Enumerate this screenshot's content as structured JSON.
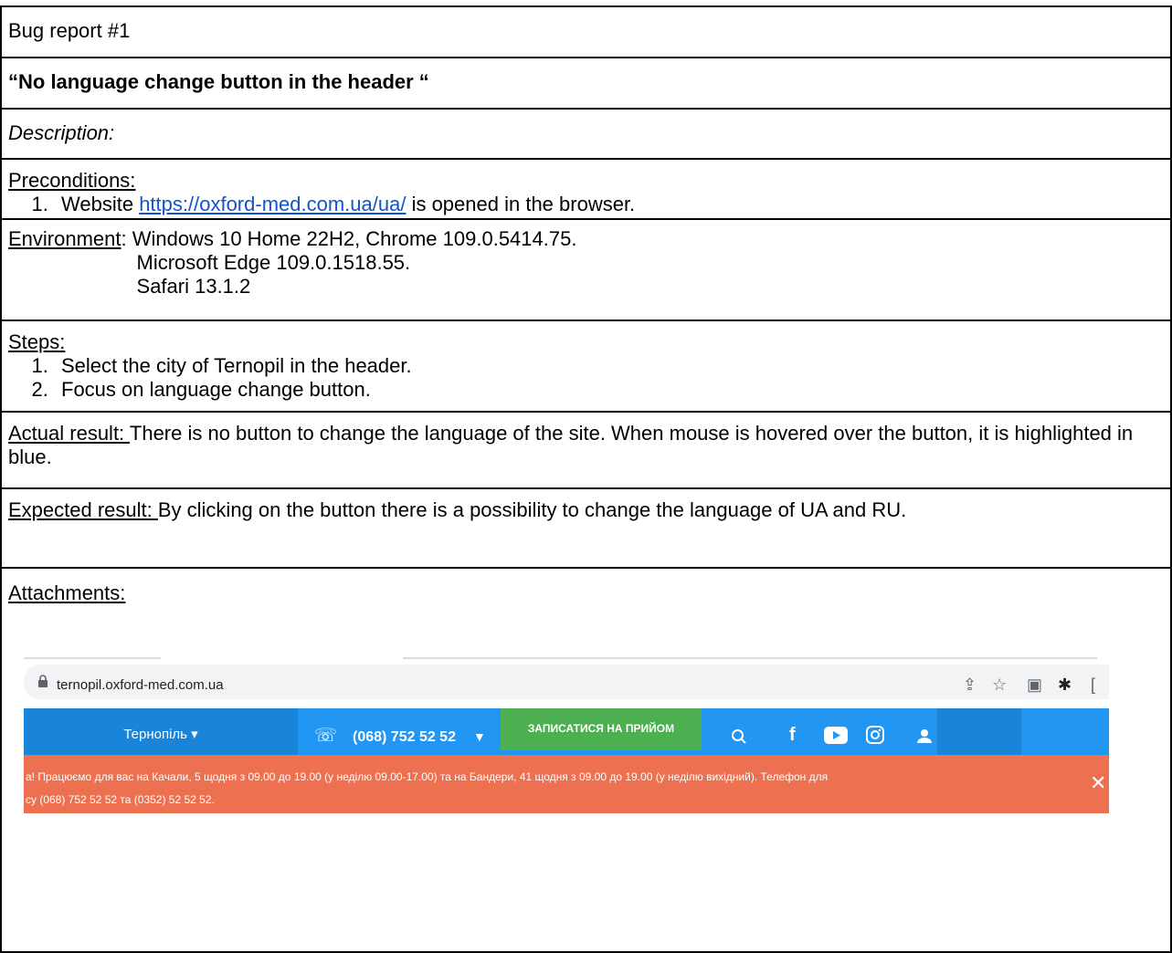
{
  "title": "Bug report #1",
  "heading": "“No language change button in the header “",
  "description_label": "Description:",
  "preconditions": {
    "label": "Preconditions:",
    "item_prefix": "Website ",
    "link": "https://oxford-med.com.ua/ua/",
    "item_suffix": " is opened in the browser."
  },
  "environment": {
    "label": "Environment",
    "line1": ": Windows 10 Home 22H2, Chrome 109.0.5414.75.",
    "line2": "Microsoft Edge 109.0.1518.55.",
    "line3": "Safari 13.1.2"
  },
  "steps": {
    "label": "Steps:",
    "items": [
      "Select the city of Ternopil in the header.",
      "Focus on language change button."
    ]
  },
  "actual": {
    "label": "Actual result: ",
    "text": "There is no button to change the language of the site. When mouse is hovered over the button, it is highlighted in blue."
  },
  "expected": {
    "label": "Expected result: ",
    "text": "By clicking on the button there is a possibility to change the language of UA and RU."
  },
  "attachments_label": "Attachments:",
  "screenshot": {
    "url": "ternopil.oxford-med.com.ua",
    "city": "Тернопіль",
    "phone": "(068) 752 52 52",
    "cta": "ЗАПИСАТИСЯ НА ПРИЙОМ",
    "notice_line1": "а! Працюємо для вас на Качали, 5 щодня з 09.00 до 19.00 (у неділю 09.00-17.00) та на Бандери, 41 щодня з 09.00 до 19.00 (у неділю вихідний). Телефон для",
    "notice_line2": "су (068) 752 52 52 та (0352) 52 52 52.",
    "colors": {
      "nav": "#2196f3",
      "cta": "#4caf50",
      "notice": "#ed7050"
    },
    "icons": [
      "lock-icon",
      "share-icon",
      "star-icon",
      "profile-icon",
      "puzzle-icon",
      "phone-icon",
      "search-icon",
      "facebook-icon",
      "youtube-icon",
      "instagram-icon",
      "user-icon",
      "close-icon"
    ]
  }
}
